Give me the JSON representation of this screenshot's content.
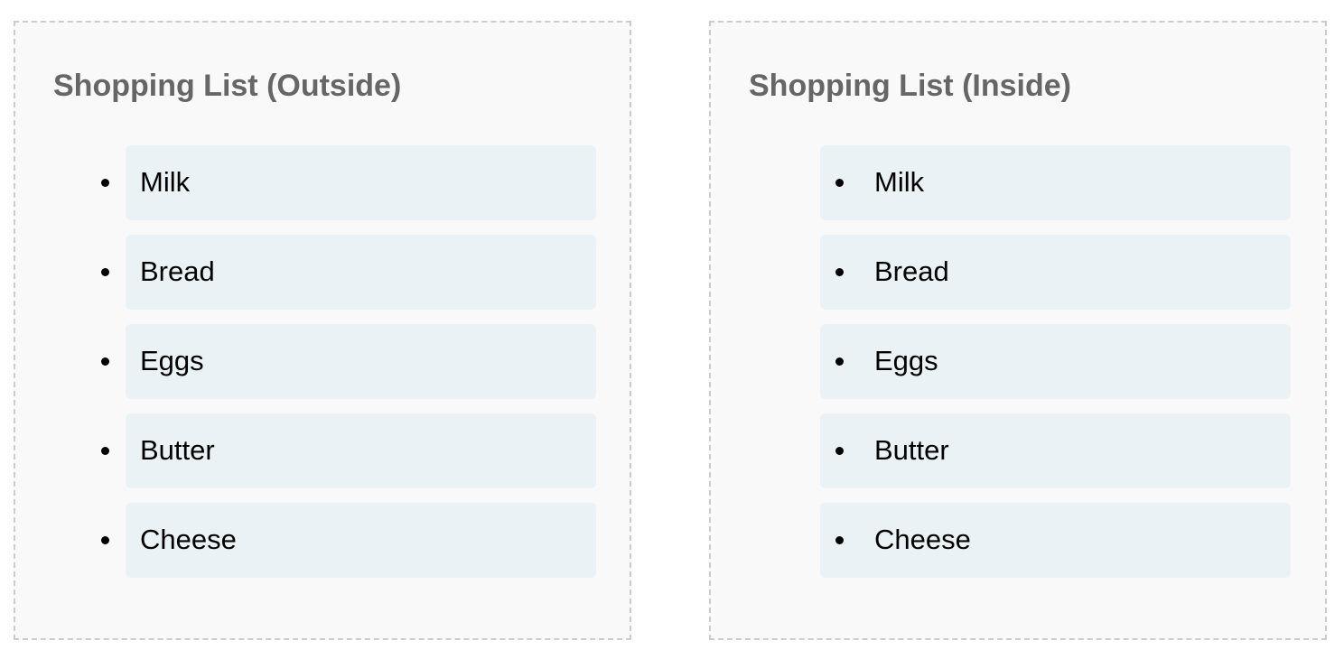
{
  "outside": {
    "title": "Shopping List (Outside)",
    "items": [
      "Milk",
      "Bread",
      "Eggs",
      "Butter",
      "Cheese"
    ]
  },
  "inside": {
    "title": "Shopping List (Inside)",
    "items": [
      "Milk",
      "Bread",
      "Eggs",
      "Butter",
      "Cheese"
    ]
  },
  "colors": {
    "panel_background": "#f9f9f9",
    "panel_border": "#cccccc",
    "title_text": "#666666",
    "item_background": "#eaf2f5",
    "item_text": "#000000"
  }
}
